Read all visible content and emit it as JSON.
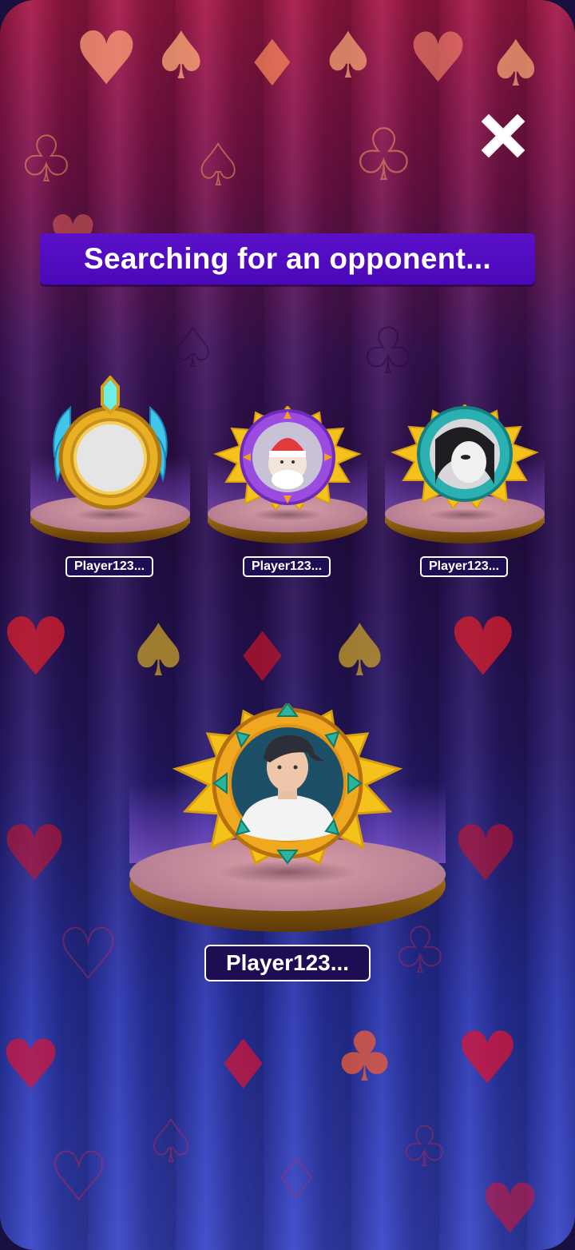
{
  "screen": {
    "title": "Searching for an opponent..."
  },
  "close_button": {
    "icon": "close-icon",
    "color": "#ffffff"
  },
  "opponents": [
    {
      "name": "Player123...",
      "frame": "gold-wings-crystal-frame",
      "avatar": "empty-avatar"
    },
    {
      "name": "Player123...",
      "frame": "purple-sunburst-frame",
      "avatar": "santa-avatar"
    },
    {
      "name": "Player123...",
      "frame": "teal-sunburst-frame",
      "avatar": "portrait-avatar"
    }
  ],
  "player": {
    "name": "Player123...",
    "frame": "gold-sunburst-frame",
    "avatar": "player-photo-avatar"
  },
  "colors": {
    "banner": "#4a08b8",
    "name_tag": "#1e0d52",
    "gold": "#f0b21a"
  }
}
